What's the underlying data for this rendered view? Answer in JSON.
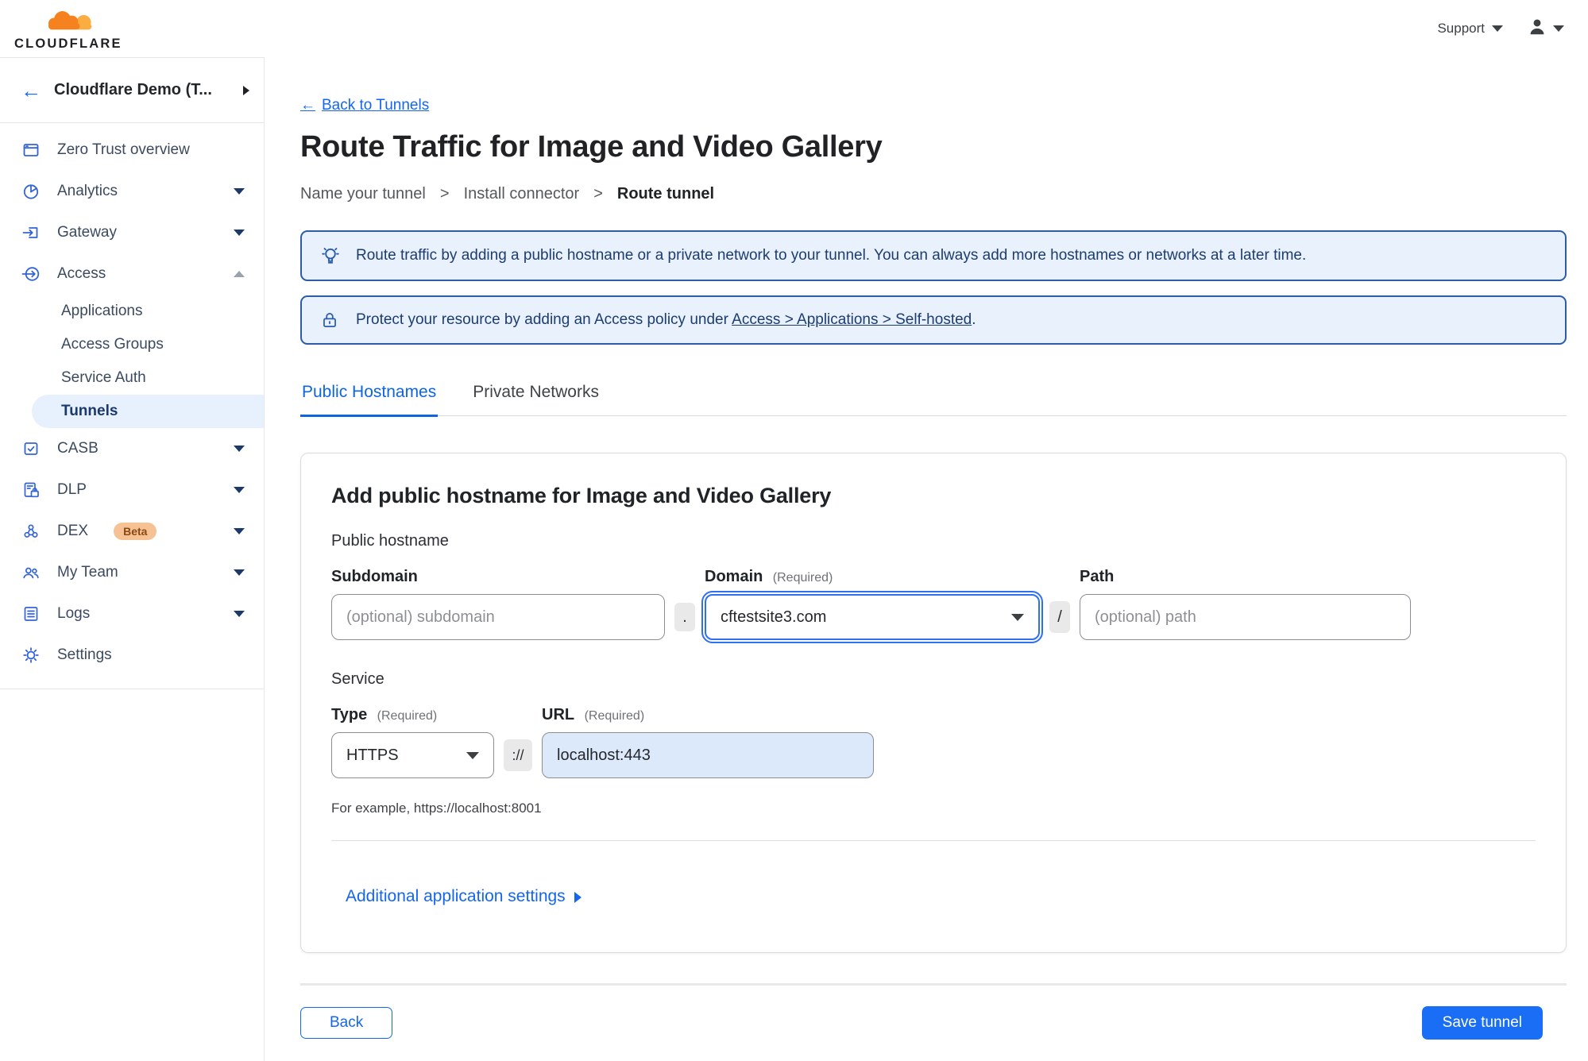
{
  "topbar": {
    "logo_text": "CLOUDFLARE",
    "support_label": "Support"
  },
  "sidebar": {
    "back_arrow": "←",
    "account_name": "Cloudflare Demo (T...",
    "zero_trust": "Zero Trust overview",
    "analytics": "Analytics",
    "gateway": "Gateway",
    "access": "Access",
    "applications": "Applications",
    "access_groups": "Access Groups",
    "service_auth": "Service Auth",
    "tunnels": "Tunnels",
    "casb": "CASB",
    "dlp": "DLP",
    "dex": "DEX",
    "dex_badge": "Beta",
    "my_team": "My Team",
    "logs": "Logs",
    "settings": "Settings"
  },
  "header": {
    "back_arrow": "←",
    "back_link": "Back to Tunnels",
    "title": "Route Traffic for Image and Video Gallery",
    "step1": "Name your tunnel",
    "step_separator": ">",
    "step2": "Install connector",
    "step3": "Route tunnel"
  },
  "banners": {
    "info_text": "Route traffic by adding a public hostname or a private network to your tunnel. You can always add more hostnames or networks at a later time.",
    "access_prefix": "Protect your resource by adding an Access policy under",
    "access_link": "Access > Applications > Self-hosted",
    "access_suffix": "."
  },
  "tabs": {
    "public_hostnames": "Public Hostnames",
    "private_networks": "Private Networks"
  },
  "form": {
    "card_title": "Add public hostname for Image and Video Gallery",
    "public_hostname_label": "Public hostname",
    "subdomain_label": "Subdomain",
    "subdomain_placeholder": "(optional) subdomain",
    "dot_separator": ".",
    "domain_label": "Domain",
    "required_tag": "(Required)",
    "domain_value": "cftestsite3.com",
    "slash_separator": "/",
    "path_label": "Path",
    "path_placeholder": "(optional) path",
    "service_label": "Service",
    "type_label": "Type",
    "type_value": "HTTPS",
    "scheme_separator": "://",
    "url_label": "URL",
    "url_value": "localhost:443",
    "url_example": "For example, https://localhost:8001",
    "additional_settings": "Additional application settings"
  },
  "footer": {
    "back_label": "Back",
    "save_label": "Save tunnel"
  },
  "colors": {
    "accent_blue": "#1466f2",
    "save_button": "#1a6ef5",
    "banner_bg": "#e8f1fc",
    "banner_border": "#2d5ca8",
    "banner_text": "#1d3c70",
    "active_pill_bg": "#e7f0fd",
    "url_input_bg": "#dce9fb",
    "beta_badge_bg": "#f6c193",
    "logo_orange": "#f6821f",
    "logo_light_orange": "#fbad41"
  }
}
